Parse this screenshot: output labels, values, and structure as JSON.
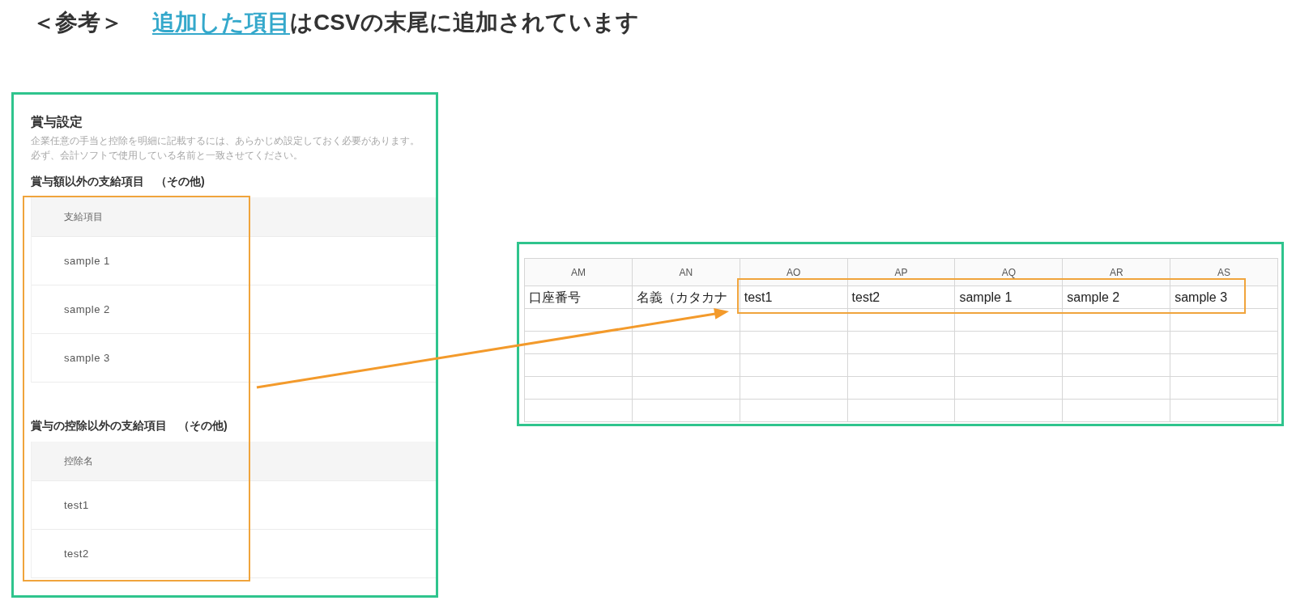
{
  "heading": {
    "label": "＜参考＞",
    "link": "追加した項目",
    "text": "はCSVの末尾に追加されています"
  },
  "settings_panel": {
    "title": "賞与設定",
    "description": [
      "企業任意の手当と控除を明細に記載するには、あらかじめ設定しておく必要があります。",
      "必ず、会計ソフトで使用している名前と一致させてください。"
    ],
    "sections": [
      {
        "heading": "賞与額以外の支給項目　（その他)",
        "column": "支給項目",
        "rows": [
          "sample 1",
          "sample 2",
          "sample 3"
        ]
      },
      {
        "heading": "賞与の控除以外の支給項目　（その他)",
        "column": "控除名",
        "rows": [
          "test1",
          "test2"
        ]
      }
    ]
  },
  "spreadsheet": {
    "columns": [
      "AM",
      "AN",
      "AO",
      "AP",
      "AQ",
      "AR",
      "AS"
    ],
    "rows": [
      [
        "口座番号",
        "名義（カタカナ",
        "test1",
        "test2",
        "sample 1",
        "sample 2",
        "sample 3"
      ]
    ]
  }
}
